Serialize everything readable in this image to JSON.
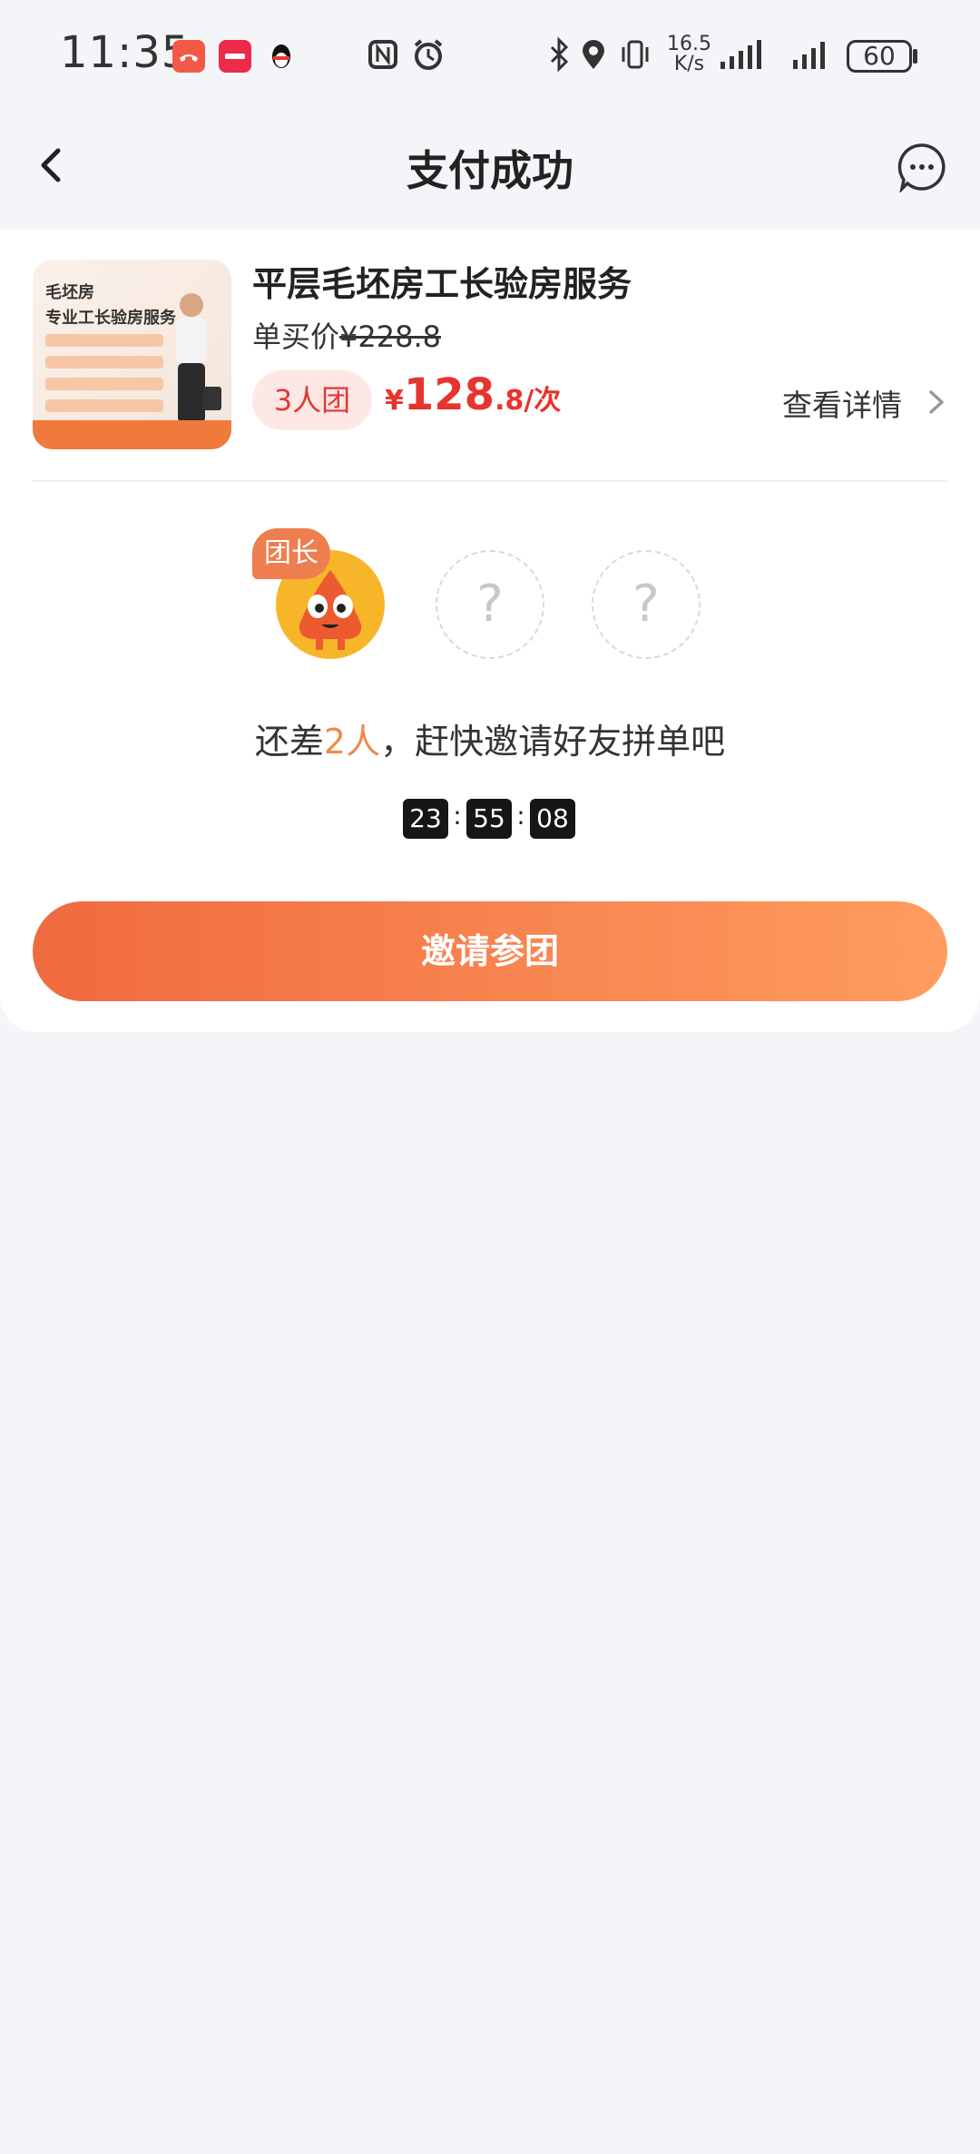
{
  "status_bar": {
    "time": "11:35",
    "net_speed_value": "16.5",
    "net_speed_unit": "K/s",
    "battery": "60",
    "icons": [
      "missed-call-icon",
      "xiaohongshu-icon",
      "qq-icon",
      "nfc-icon",
      "alarm-icon",
      "bluetooth-icon",
      "location-icon",
      "vibrate-icon",
      "signal-icon",
      "signal-icon"
    ]
  },
  "nav": {
    "title": "支付成功",
    "back_icon": "chevron-left-icon",
    "message_icon": "chat-bubble-icon"
  },
  "product": {
    "title": "平层毛坯房工长验房服务",
    "single_price_label": "单买价",
    "single_price": "¥228.8",
    "group_tag": "3人团",
    "group_price_currency": "¥",
    "group_price_int": "128",
    "group_price_dec": ".8/次",
    "details_label": "查看详情",
    "thumb": {
      "line1": "毛坯房",
      "line2": "专业工长验房服务"
    }
  },
  "group": {
    "leader_badge": "团长",
    "empty_slot_symbol": "?",
    "invite_prefix": "还差",
    "invite_count": "2人",
    "invite_suffix": "，赶快邀请好友拼单吧",
    "timer": {
      "h": "23",
      "m": "55",
      "s": "08",
      "sep": ":"
    }
  },
  "cta": {
    "label": "邀请参团"
  },
  "colors": {
    "accent": "#f06a3f",
    "accent_end": "#ff9c5f",
    "price_red": "#e8332e",
    "background": "#f4f5f9"
  }
}
